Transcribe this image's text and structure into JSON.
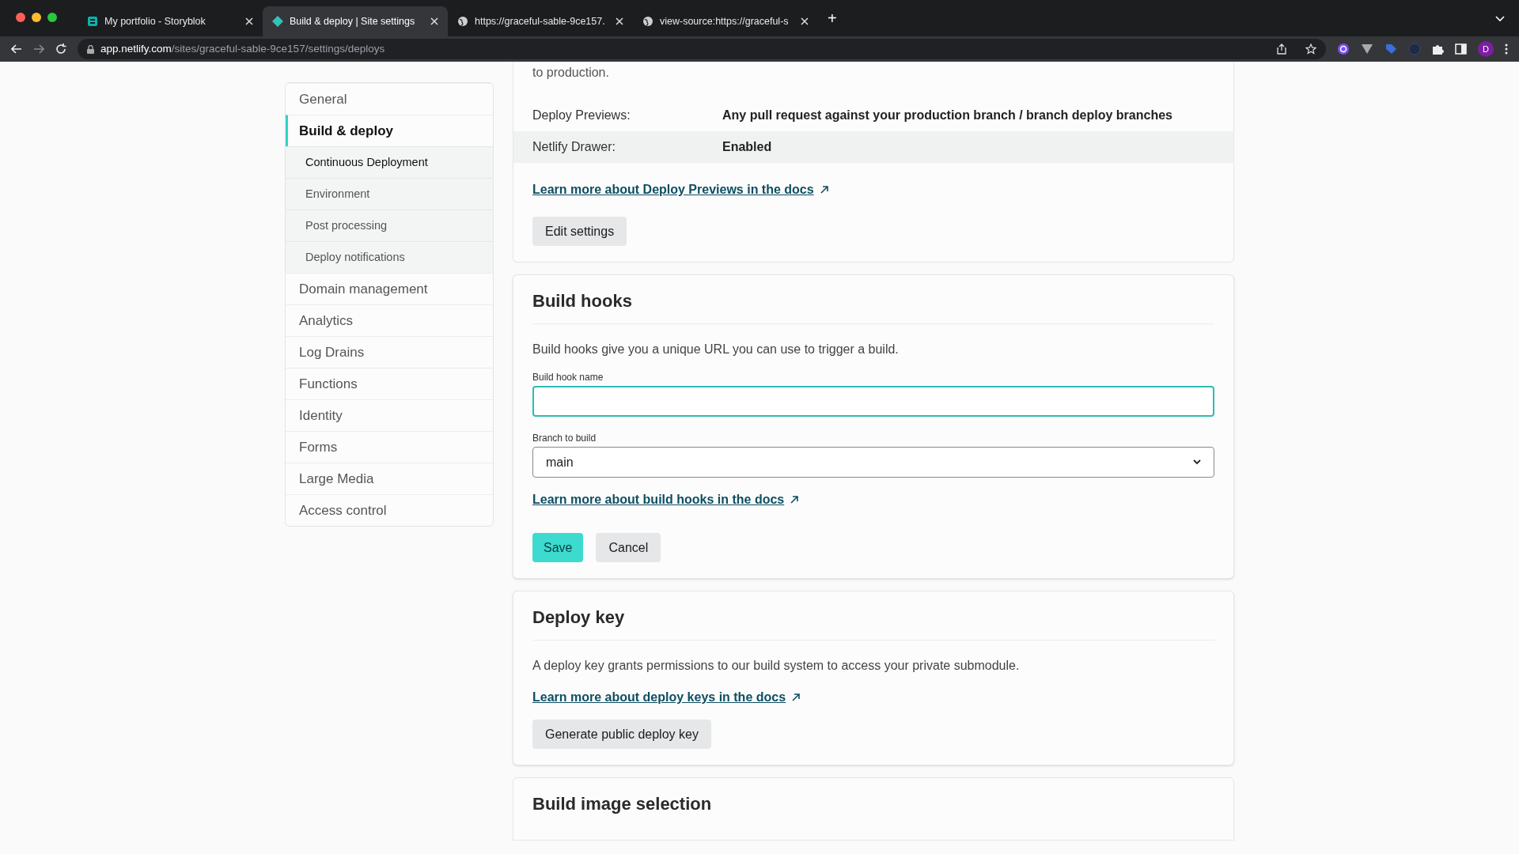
{
  "browser": {
    "tabs": [
      {
        "title": "My portfolio - Storyblok",
        "selected": false
      },
      {
        "title": "Build & deploy | Site settings",
        "selected": true
      },
      {
        "title": "https://graceful-sable-9ce157.",
        "selected": false
      },
      {
        "title": "view-source:https://graceful-s",
        "selected": false
      }
    ],
    "new_tab": "+",
    "url_host": "app.netlify.com",
    "url_path": "/sites/graceful-sable-9ce157/settings/deploys",
    "profile_initial": "D"
  },
  "sidebar": {
    "items": [
      {
        "label": "General",
        "selected": false
      },
      {
        "label": "Build & deploy",
        "selected": true,
        "children": [
          {
            "label": "Continuous Deployment",
            "selected": true
          },
          {
            "label": "Environment",
            "selected": false
          },
          {
            "label": "Post processing",
            "selected": false
          },
          {
            "label": "Deploy notifications",
            "selected": false
          }
        ]
      },
      {
        "label": "Domain management",
        "selected": false
      },
      {
        "label": "Analytics",
        "selected": false
      },
      {
        "label": "Log Drains",
        "selected": false
      },
      {
        "label": "Functions",
        "selected": false
      },
      {
        "label": "Identity",
        "selected": false
      },
      {
        "label": "Forms",
        "selected": false
      },
      {
        "label": "Large Media",
        "selected": false
      },
      {
        "label": "Access control",
        "selected": false
      }
    ]
  },
  "deploy_previews": {
    "intro_text": "to production.",
    "settings": [
      {
        "label": "Deploy Previews:",
        "value": "Any pull request against your production branch / branch deploy branches",
        "highlighted": false
      },
      {
        "label": "Netlify Drawer:",
        "value": "Enabled",
        "highlighted": true
      }
    ],
    "link": "Learn more about Deploy Previews in the docs",
    "button": "Edit settings"
  },
  "build_hooks": {
    "title": "Build hooks",
    "description": "Build hooks give you a unique URL you can use to trigger a build.",
    "name_field": {
      "label": "Build hook name",
      "focused": true
    },
    "branch_select": {
      "label": "Branch to build",
      "value": "main"
    },
    "link": "Learn more about build hooks in the docs",
    "buttons": [
      {
        "label": "Save",
        "kind": "primary"
      },
      {
        "label": "Cancel",
        "kind": "secondary"
      }
    ]
  },
  "deploy_key": {
    "title": "Deploy key",
    "description": "A deploy key grants permissions to our build system to access your private submodule.",
    "link": "Learn more about deploy keys in the docs",
    "button": "Generate public deploy key"
  },
  "build_image": {
    "title": "Build image selection"
  }
}
